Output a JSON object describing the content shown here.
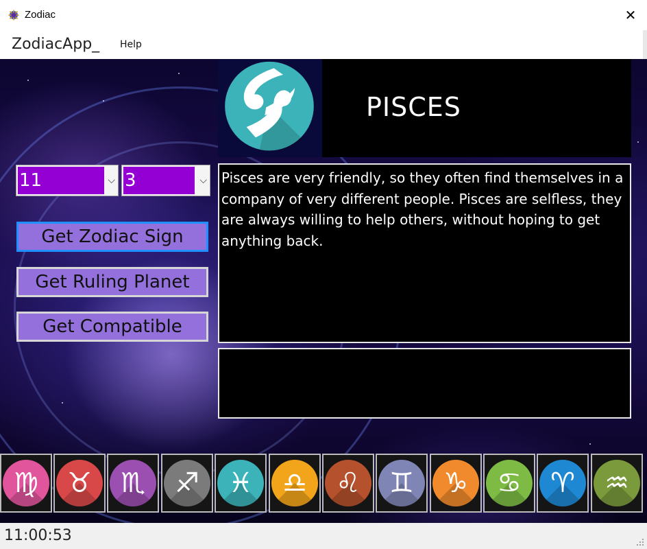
{
  "window": {
    "title": "Zodiac",
    "close_glyph": "✕"
  },
  "menu": {
    "app_label": "ZodiacApp_",
    "help_label": "Help"
  },
  "selectors": {
    "month": "11",
    "day": "3"
  },
  "buttons": {
    "zodiac_sign": "Get Zodiac Sign",
    "ruling_planet": "Get Ruling Planet",
    "compatible": "Get Compatible"
  },
  "sign": {
    "name": "PISCES",
    "icon": "pisces-icon",
    "icon_bg": "#3bb3b8"
  },
  "description": "Pisces are very friendly, so they often find themselves in a company of very different people. Pisces are selfless, they are always willing to help others, without hoping to get anything back.",
  "result": "",
  "zodiac_icons": [
    {
      "name": "virgo-icon",
      "glyph": "♍",
      "color": "#e0559c"
    },
    {
      "name": "taurus-icon",
      "glyph": "♉",
      "color": "#d94848"
    },
    {
      "name": "scorpio-icon",
      "glyph": "♏",
      "color": "#9b4fb0"
    },
    {
      "name": "sagittarius-icon",
      "glyph": "♐",
      "color": "#7b7b7b"
    },
    {
      "name": "pisces-icon",
      "glyph": "♓",
      "color": "#3bb3b8"
    },
    {
      "name": "libra-icon",
      "glyph": "♎",
      "color": "#f2a51a"
    },
    {
      "name": "leo-icon",
      "glyph": "♌",
      "color": "#b5512d"
    },
    {
      "name": "gemini-icon",
      "glyph": "♊",
      "color": "#7f86b5"
    },
    {
      "name": "capricorn-icon",
      "glyph": "♑",
      "color": "#f08a2c"
    },
    {
      "name": "cancer-icon",
      "glyph": "♋",
      "color": "#7dbb44"
    },
    {
      "name": "aries-icon",
      "glyph": "♈",
      "color": "#1e88d2"
    },
    {
      "name": "aquarius-icon",
      "glyph": "♒",
      "color": "#7a9a3c"
    }
  ],
  "status": {
    "time": "11:00:53"
  },
  "colors": {
    "select_bg": "#9400d3",
    "button_bg": "#9370db",
    "focus_border": "#1e90ff"
  }
}
